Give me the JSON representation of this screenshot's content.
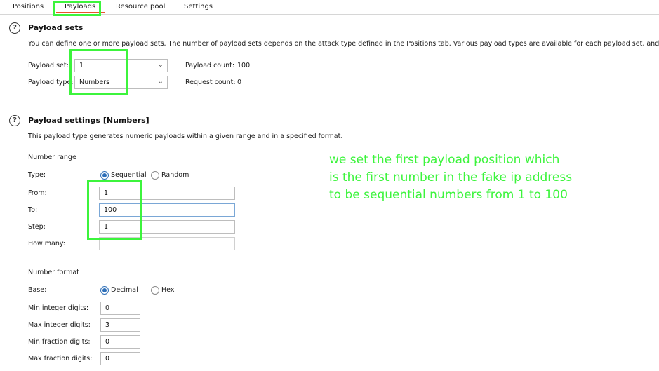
{
  "tabs": [
    {
      "label": "Positions"
    },
    {
      "label": "Payloads"
    },
    {
      "label": "Resource pool"
    },
    {
      "label": "Settings"
    }
  ],
  "payload_sets": {
    "title": "Payload sets",
    "description": "You can define one or more payload sets. The number of payload sets depends on the attack type defined in the Positions tab. Various payload types are available for each payload set, and each payload t",
    "set_label": "Payload set:",
    "set_value": "1",
    "type_label": "Payload type:",
    "type_value": "Numbers",
    "count_label": "Payload count:",
    "count_value": "100",
    "request_label": "Request count:",
    "request_value": "0"
  },
  "payload_settings": {
    "title": "Payload settings [Numbers]",
    "description": "This payload type generates numeric payloads within a given range and in a specified format.",
    "number_range": {
      "heading": "Number range",
      "type_label": "Type:",
      "sequential_label": "Sequential",
      "random_label": "Random",
      "from_label": "From:",
      "from_value": "1",
      "to_label": "To:",
      "to_value": "100",
      "step_label": "Step:",
      "step_value": "1",
      "howmany_label": "How many:",
      "howmany_value": ""
    },
    "number_format": {
      "heading": "Number format",
      "base_label": "Base:",
      "decimal_label": "Decimal",
      "hex_label": "Hex",
      "min_int_label": "Min integer digits:",
      "min_int_value": "0",
      "max_int_label": "Max integer digits:",
      "max_int_value": "3",
      "min_frac_label": "Min fraction digits:",
      "min_frac_value": "0",
      "max_frac_label": "Max fraction digits:",
      "max_frac_value": "0"
    }
  },
  "annotation": "we set the first payload position which\nis the first number in the fake ip address\nto be sequential numbers from 1 to 100",
  "colors": {
    "highlight": "#3cf43c",
    "active_tab_underline": "#e8542a",
    "radio_selected": "#2e6fb8"
  }
}
